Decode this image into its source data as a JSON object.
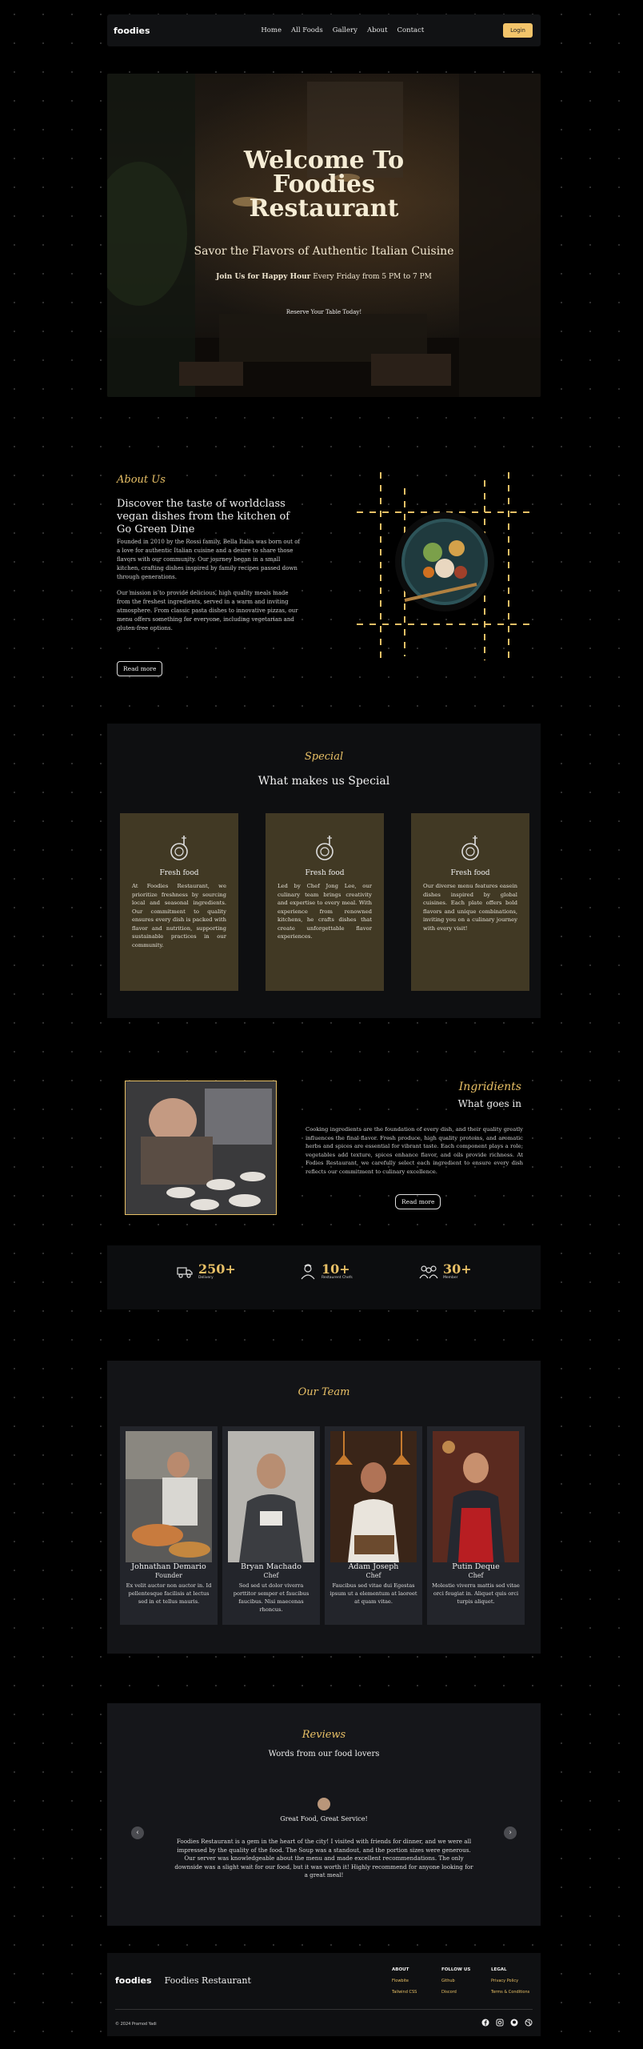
{
  "nav": {
    "logo": "foodies",
    "links": [
      "Home",
      "All Foods",
      "Gallery",
      "About",
      "Contact"
    ],
    "login": "Login"
  },
  "hero": {
    "title_line1": "Welcome To",
    "title_line2": "Foodies",
    "title_line3": "Restaurant",
    "subtitle": "Savor the Flavors of Authentic Italian Cuisine",
    "happy_bold": "Join Us for Happy Hour",
    "happy_rest": " Every Friday from 5 PM to 7 PM",
    "reserve": "Reserve Your Table Today!"
  },
  "about": {
    "heading": "About Us",
    "subheading": "Discover the taste of worldclass vegan dishes from the kitchen of Go Green Dine",
    "para1": "Founded in 2010 by the Rossi family, Bella Italia was born out of a love for authentic Italian cuisine and a desire to share those flavors with our community. Our journey began in a small kitchen, crafting dishes inspired by family recipes passed down through generations.",
    "para2": "Our mission is to provide delicious, high quality meals made from the freshest ingredients, served in a warm and inviting atmosphere. From classic pasta dishes to innovative pizzas, our menu offers something for everyone, including vegetarian and gluten-free options.",
    "button": "Read more"
  },
  "special": {
    "heading": "Special",
    "title": "What makes us Special",
    "cards": [
      {
        "title": "Fresh food",
        "desc": "At Foodies Restaurant, we prioritize freshness by sourcing local and seasonal ingredients. Our commitment to quality ensures every dish is packed with flavor and nutrition, supporting sustainable practices in our community."
      },
      {
        "title": "Fresh food",
        "desc": "Led by Chef Jong Lee, our culinary team brings creativity and expertise to every meal. With experience from renowned kitchens, he crafts dishes that create unforgettable flavor experiences."
      },
      {
        "title": "Fresh food",
        "desc": "Our diverse menu features easein dishes inspired by global cuisines. Each plate offers bold flavors and unique combinations, inviting you on a culinary journey with every visit!"
      }
    ]
  },
  "ingredients": {
    "heading": "Ingridients",
    "title": "What goes in",
    "para": "Cooking ingredients are the foundation of every dish, and their quality greatly influences the final flavor. Fresh produce, high quality proteins, and aromatic herbs and spices are essential for vibrant taste. Each component plays a role; vegetables add texture, spices enhance flavor, and oils provide richness. At Fodies Restaurant, we carefully select each ingredient to ensure every dish reflects our commitment to culinary excellence.",
    "button": "Read more"
  },
  "stats": [
    {
      "num": "250+",
      "label": "Delivery"
    },
    {
      "num": "10+",
      "label": "Restaurent Chefs"
    },
    {
      "num": "30+",
      "label": "Member"
    }
  ],
  "team": {
    "heading": "Our Team",
    "members": [
      {
        "name": "Johnathan Demario",
        "role": "Founder",
        "bio": "Ex velit auctor non auctor in. Id pellentesque facilisis at lectus sed in et tellus mauris."
      },
      {
        "name": "Bryan Machado",
        "role": "Chef",
        "bio": "Sed sed ut dolor viverra porttitor semper et faucibus faucibus. Nisi maecenas rhoncus."
      },
      {
        "name": "Adam Joseph",
        "role": "Chef",
        "bio": "Faucibus sed vitae dui Egestas ipsum ut a elementum at laoreet at quam vitae."
      },
      {
        "name": "Putin Deque",
        "role": "Chef",
        "bio": "Molestie viverra mattis sed vitae orci feugiat in. Aliquet quis orci turpis aliquet."
      }
    ]
  },
  "reviews": {
    "heading": "Reviews",
    "title": "Words from our food lovers",
    "review_title": "Great Food, Great Service!",
    "review_text": "Foodies Restaurant is a gem in the heart of the city! I visited with friends for dinner, and we were all impressed by the quality of the food. The Soup was a standout, and the portion sizes were generous. Our server was knowledgeable about the menu and made excellent recommendations. The only downside was a slight wait for our food, but it was worth it! Highly recommend for anyone looking for a great meal!"
  },
  "footer": {
    "logo": "foodies",
    "name": "Foodies Restaurant",
    "copyright": "© 2024 Pramod Yadi",
    "columns": [
      {
        "title": "ABOUT",
        "items": [
          "Flowbite",
          "Tailwind CSS"
        ]
      },
      {
        "title": "FOLLOW US",
        "items": [
          "Github",
          "Discord"
        ]
      },
      {
        "title": "LEGAL",
        "items": [
          "Privacy Policy",
          "Terms & Conditions"
        ]
      }
    ]
  },
  "colors": {
    "accent": "#e8c066",
    "card": "#413924",
    "background": "#000000"
  }
}
